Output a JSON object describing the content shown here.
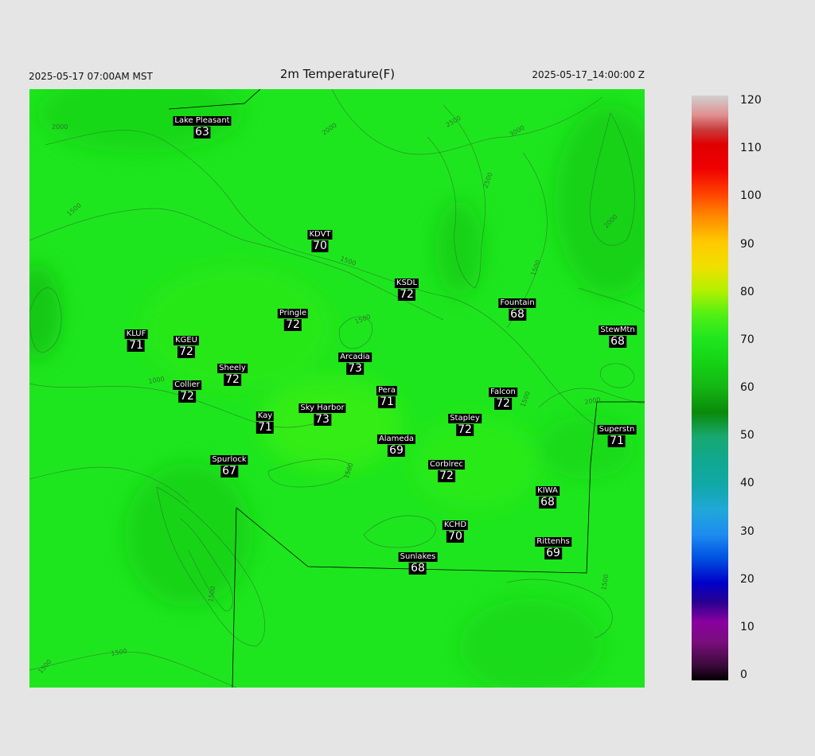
{
  "header": {
    "valid_time_local": "2025-05-17 07:00AM MST",
    "title": "2m Temperature(F)",
    "valid_time_utc": "2025-05-17_14:00:00 Z"
  },
  "map": {
    "background_color": "#1ee61e",
    "contour_labels": [
      "2000",
      "2000",
      "2500",
      "3000",
      "2500",
      "2000",
      "1500",
      "1500",
      "1500",
      "1500",
      "1000",
      "1500",
      "1500",
      "2000",
      "1500",
      "1500",
      "1500",
      "1500"
    ],
    "stations": [
      {
        "name": "Lake Pleasant",
        "temp": "63"
      },
      {
        "name": "KDVT",
        "temp": "70"
      },
      {
        "name": "KSDL",
        "temp": "72"
      },
      {
        "name": "Fountain",
        "temp": "68"
      },
      {
        "name": "StewMtn",
        "temp": "68"
      },
      {
        "name": "Pringle",
        "temp": "72"
      },
      {
        "name": "KLUF",
        "temp": "71"
      },
      {
        "name": "KGEU",
        "temp": "72"
      },
      {
        "name": "Arcadia",
        "temp": "73"
      },
      {
        "name": "Sheely",
        "temp": "72"
      },
      {
        "name": "Collier",
        "temp": "72"
      },
      {
        "name": "Pera",
        "temp": "71"
      },
      {
        "name": "Falcon",
        "temp": "72"
      },
      {
        "name": "Kay",
        "temp": "71"
      },
      {
        "name": "Sky Harbor",
        "temp": "73"
      },
      {
        "name": "Stapley",
        "temp": "72"
      },
      {
        "name": "Superstn",
        "temp": "71"
      },
      {
        "name": "Alameda",
        "temp": "69"
      },
      {
        "name": "Spurlock",
        "temp": "67"
      },
      {
        "name": "Corblrec",
        "temp": "72"
      },
      {
        "name": "KIWA",
        "temp": "68"
      },
      {
        "name": "KCHD",
        "temp": "70"
      },
      {
        "name": "Rittenhs",
        "temp": "69"
      },
      {
        "name": "Sunlakes",
        "temp": "68"
      }
    ]
  },
  "colorbar": {
    "min": 0,
    "max": 120,
    "ticks": [
      "120",
      "110",
      "100",
      "90",
      "80",
      "70",
      "60",
      "50",
      "40",
      "30",
      "20",
      "10",
      "0"
    ],
    "stops": [
      {
        "value": 0,
        "color": "#000000"
      },
      {
        "value": 3,
        "color": "#3a0a3a"
      },
      {
        "value": 8,
        "color": "#7a0e7e"
      },
      {
        "value": 12,
        "color": "#8a00a0"
      },
      {
        "value": 16,
        "color": "#2a0090"
      },
      {
        "value": 20,
        "color": "#0000c8"
      },
      {
        "value": 25,
        "color": "#0050e0"
      },
      {
        "value": 30,
        "color": "#1e8cf0"
      },
      {
        "value": 35,
        "color": "#20a8d8"
      },
      {
        "value": 40,
        "color": "#10a8a8"
      },
      {
        "value": 45,
        "color": "#10a890"
      },
      {
        "value": 50,
        "color": "#18a870"
      },
      {
        "value": 55,
        "color": "#0a8a0a"
      },
      {
        "value": 60,
        "color": "#14b414"
      },
      {
        "value": 65,
        "color": "#14d214"
      },
      {
        "value": 70,
        "color": "#1ee61e"
      },
      {
        "value": 75,
        "color": "#50f014"
      },
      {
        "value": 80,
        "color": "#b4f000"
      },
      {
        "value": 85,
        "color": "#f0e000"
      },
      {
        "value": 90,
        "color": "#ffc800"
      },
      {
        "value": 95,
        "color": "#ff8c00"
      },
      {
        "value": 100,
        "color": "#ff4000"
      },
      {
        "value": 105,
        "color": "#f00000"
      },
      {
        "value": 110,
        "color": "#e00000"
      },
      {
        "value": 113,
        "color": "#c83c3c"
      },
      {
        "value": 116,
        "color": "#e09090"
      },
      {
        "value": 120,
        "color": "#d0d0d0"
      }
    ]
  }
}
